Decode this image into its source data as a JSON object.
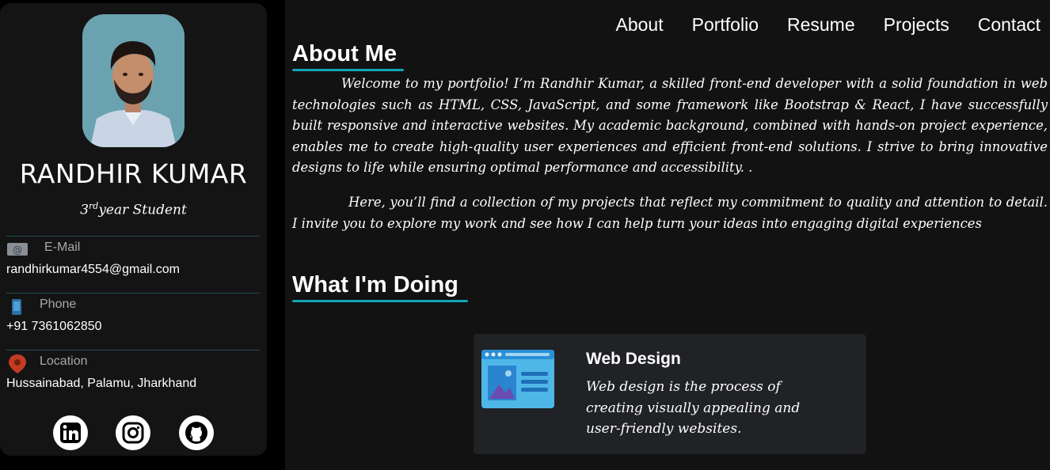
{
  "profile": {
    "name": "RANDHIR KUMAR",
    "role_prefix": "3",
    "role_sup": "rd",
    "role_suffix": "year Student"
  },
  "contact": {
    "email_label": "E-Mail",
    "email_value": "randhirkumar4554@gmail.com",
    "phone_label": "Phone",
    "phone_value": "+91 7361062850",
    "location_label": "Location",
    "location_value": "Hussainabad, Palamu, Jharkhand"
  },
  "social": [
    "linkedin-icon",
    "instagram-icon",
    "github-icon"
  ],
  "nav": [
    "About",
    "Portfolio",
    "Resume",
    "Projects",
    "Contact"
  ],
  "about": {
    "title": "About Me",
    "p1": "Welcome to my portfolio! I’m Randhir Kumar, a skilled front-end developer with a solid foundation in web technologies such as HTML, CSS, JavaScript, and some framework like Bootstrap & React, I have successfully built responsive and interactive websites. My academic background, combined with hands-on project experience, enables me to create high-quality user experiences and efficient front-end solutions. I strive to bring innovative designs to life while ensuring optimal performance and accessibility. .",
    "p2": "Here, you’ll find a collection of my projects that reflect my commitment to quality and attention to detail. I invite you to explore my work and see how I can help turn your ideas into engaging digital experiences"
  },
  "doing": {
    "title": "What I'm Doing",
    "card_title": "Web Design",
    "card_desc": "Web design is the process of creating visually appealing and user-friendly websites."
  },
  "colors": {
    "accent": "#13a4b7",
    "sidebar_bg": "#141414",
    "main_bg": "#121212",
    "card_bg": "#202226"
  }
}
